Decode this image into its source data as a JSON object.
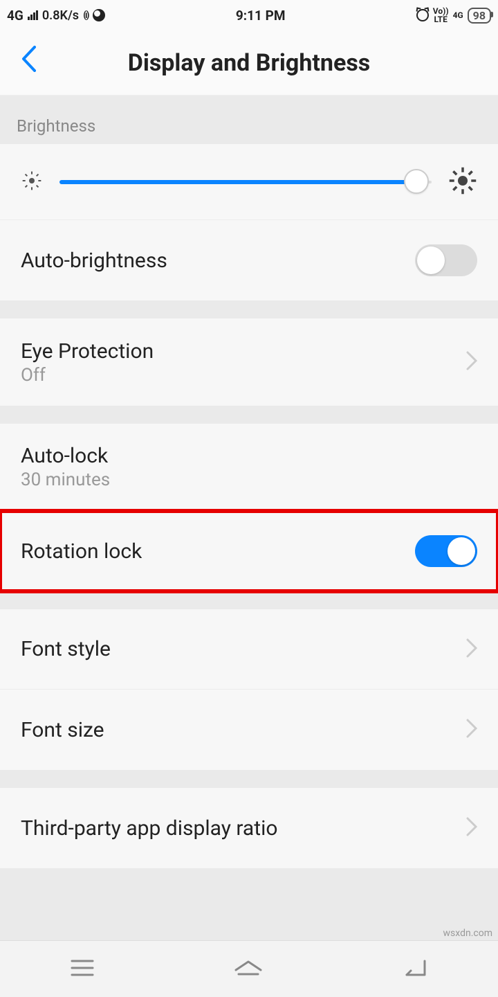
{
  "status": {
    "network": "4G",
    "speed": "0.8K/s",
    "time": "9:11 PM",
    "volte_top": "Vo))",
    "volte_bot": "LTE",
    "net2": "4G",
    "battery": "98"
  },
  "header": {
    "title": "Display and Brightness"
  },
  "section": {
    "brightness_label": "Brightness"
  },
  "rows": {
    "auto_brightness": "Auto-brightness",
    "eye_protection": "Eye Protection",
    "eye_protection_val": "Off",
    "auto_lock": "Auto-lock",
    "auto_lock_val": "30 minutes",
    "rotation_lock": "Rotation lock",
    "font_style": "Font style",
    "font_size": "Font size",
    "third_party": "Third-party app display ratio"
  },
  "toggles": {
    "auto_brightness": false,
    "rotation_lock": true
  },
  "slider": {
    "brightness_pct": 96
  },
  "watermark": "wsxdn.com"
}
